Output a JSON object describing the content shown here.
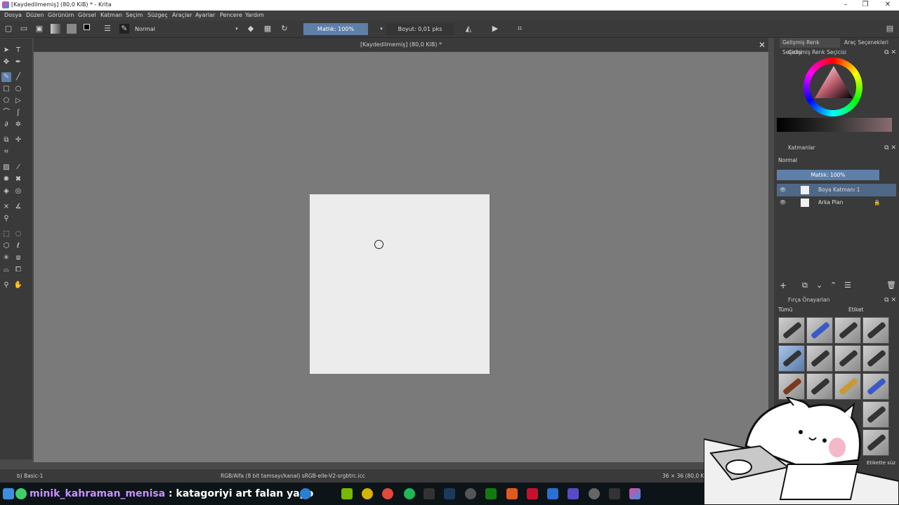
{
  "window": {
    "title": "[Kaydedilmemiş] (80,0 KiB) * - Krita"
  },
  "menu": [
    "Dosya",
    "Düzen",
    "Görünüm",
    "Görsel",
    "Katman",
    "Seçim",
    "Süzgeç",
    "Araçlar",
    "Ayarlar",
    "Pencere",
    "Yardım"
  ],
  "toolbar": {
    "blend_mode": "Normal",
    "opacity": "Matlık: 100%",
    "size": "Boyut: 0,01 pks"
  },
  "document": {
    "tab_title": "[Kaydedilmemiş] (80,0 KiB) *"
  },
  "dock": {
    "color_tabs": [
      "Gelişmiş Renk Seçicisi",
      "Araç Seçenekleri"
    ],
    "color_title": "Gelişmiş Renk Seçicisi",
    "layers_title": "Katmanlar",
    "layers_blend": "Normal",
    "layers_opacity": "Matlık: 100%",
    "layers": [
      {
        "name": "Boya Katmanı 1",
        "selected": true
      },
      {
        "name": "Arka Plan",
        "selected": false
      }
    ],
    "brush_title": "Fırça Önayarları",
    "brush_filter": "Tümü",
    "brush_tag": "Etiket",
    "brush_tag_search": "Etikette süz"
  },
  "status": {
    "brush": "b) Basic-1",
    "color_profile": "RGB/Alfa (8 bit tamsayı/kanal) sRGB-elle-V2-srgbtrc.icc",
    "dimensions": "36 × 36 (80,0 Ki"
  },
  "stream": {
    "chat_user": "minik_kahraman_menisa",
    "chat_sep": ":",
    "chat_msg": "katagoriyi art falan yapo"
  },
  "colors": {
    "accent": "#5e7fa8",
    "canvas_bg": "#7a7a7a",
    "panel": "#3a3a3a"
  }
}
